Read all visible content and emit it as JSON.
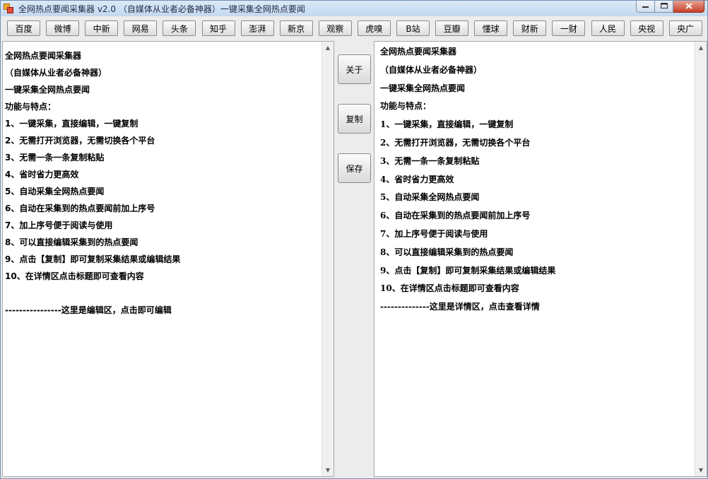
{
  "window": {
    "title": "全网热点要闻采集器  v2.0  （自媒体从业者必备神器）一键采集全网热点要闻"
  },
  "toolbar": {
    "sources": [
      "百度",
      "微博",
      "中新",
      "网易",
      "头条",
      "知乎",
      "澎湃",
      "新京",
      "观察",
      "虎嗅",
      "B站",
      "豆瓣",
      "懂球",
      "财新",
      "一财",
      "人民",
      "央视",
      "央广"
    ]
  },
  "actions": {
    "about": "关于",
    "copy": "复制",
    "save": "保存"
  },
  "editor": {
    "lines": [
      "全网热点要闻采集器",
      "（自媒体从业者必备神器）",
      "一键采集全网热点要闻",
      "功能与特点：",
      "1、一键采集，直接编辑，一键复制",
      "2、无需打开浏览器，无需切换各个平台",
      "3、无需一条一条复制粘贴",
      "4、省时省力更高效",
      "5、自动采集全网热点要闻",
      "6、自动在采集到的热点要闻前加上序号",
      "7、加上序号便于阅读与使用",
      "8、可以直接编辑采集到的热点要闻",
      "9、点击【复制】即可复制采集结果或编辑结果",
      "10、在详情区点击标题即可查看内容",
      "",
      "----------------这里是编辑区，点击即可编辑"
    ]
  },
  "detail": {
    "lines": [
      "全网热点要闻采集器",
      "（自媒体从业者必备神器）",
      "一键采集全网热点要闻",
      "功能与特点：",
      "1、一键采集，直接编辑，一键复制",
      "2、无需打开浏览器，无需切换各个平台",
      "3、无需一条一条复制粘贴",
      "4、省时省力更高效",
      "5、自动采集全网热点要闻",
      "6、自动在采集到的热点要闻前加上序号",
      "7、加上序号便于阅读与使用",
      "8、可以直接编辑采集到的热点要闻",
      "9、点击【复制】即可复制采集结果或编辑结果",
      "10、在详情区点击标题即可查看内容",
      "--------------这里是详情区，点击查看详情"
    ]
  },
  "icons": {
    "minimize": "minimize-icon",
    "maximize": "maximize-icon",
    "close": "close-icon",
    "scroll_up": "scroll-up-arrow-icon",
    "scroll_down": "scroll-down-arrow-icon"
  }
}
